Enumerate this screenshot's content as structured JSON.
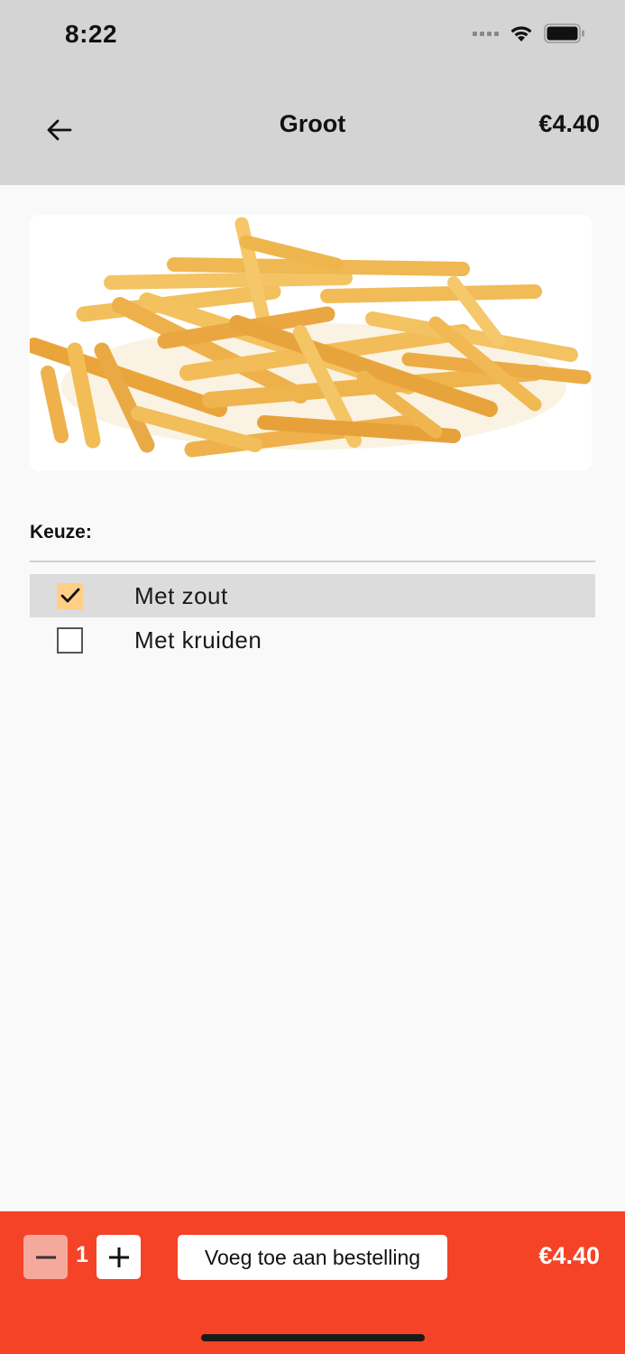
{
  "status_bar": {
    "time": "8:22",
    "icons": [
      "cellular-signal-icon",
      "wifi-icon",
      "battery-icon"
    ]
  },
  "header": {
    "title": "Groot",
    "price": "€4.40",
    "back_icon": "arrow-left-icon"
  },
  "product": {
    "image": "french-fries"
  },
  "options": {
    "label": "Keuze:",
    "items": [
      {
        "label": "Met zout",
        "checked": true
      },
      {
        "label": "Met kruiden",
        "checked": false
      }
    ]
  },
  "footer": {
    "quantity": "1",
    "minus_icon": "minus-icon",
    "plus_icon": "plus-icon",
    "add_label": "Voeg toe aan bestelling",
    "total": "€4.40"
  },
  "colors": {
    "header_bg": "#d4d4d4",
    "footer_bg": "#f44326",
    "checkbox_checked": "#ffcf86",
    "selected_row": "#dcdcdc"
  }
}
